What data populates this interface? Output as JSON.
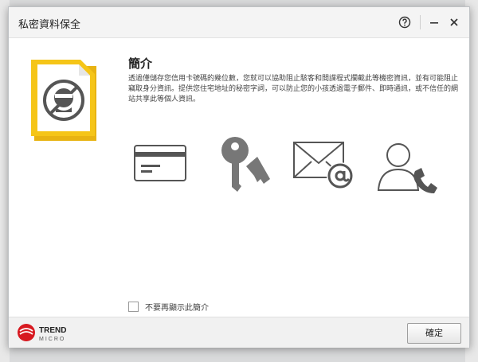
{
  "dialog": {
    "title": "私密資料保全",
    "help_icon": "help-circle-icon",
    "minimize_icon": "minimize-icon",
    "close_icon": "close-icon"
  },
  "intro": {
    "heading": "簡介",
    "description": "透過僅儲存您信用卡號碼的幾位數，您就可以協助阻止駭客和間諜程式攔截此等機密資訊，並有可能阻止竊取身分資訊。提供您住宅地址的秘密字詞，可以防止您的小孩透過電子郵件、即時通訊，或不信任的網站共享此等個人資訊。"
  },
  "features": [
    {
      "icon": "credit-card-icon"
    },
    {
      "icon": "keys-icon"
    },
    {
      "icon": "email-at-icon"
    },
    {
      "icon": "phone-contact-icon"
    }
  ],
  "options": {
    "dont_show_label": "不要再顯示此簡介",
    "dont_show_checked": false
  },
  "footer": {
    "brand_line1": "TREND",
    "brand_line2": "MICRO",
    "ok_label": "確定"
  },
  "colors": {
    "accent_yellow": "#f5c518",
    "brand_red": "#d71920",
    "icon_gray": "#666666"
  }
}
